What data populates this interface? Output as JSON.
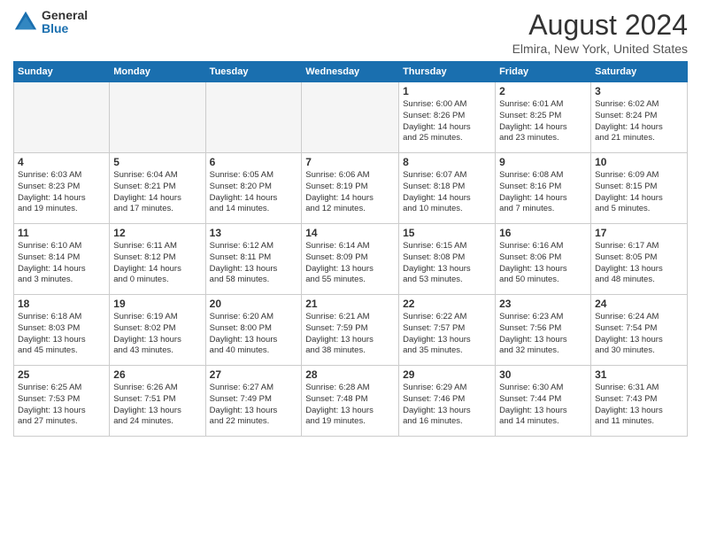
{
  "header": {
    "logo_general": "General",
    "logo_blue": "Blue",
    "month_title": "August 2024",
    "location": "Elmira, New York, United States"
  },
  "weekdays": [
    "Sunday",
    "Monday",
    "Tuesday",
    "Wednesday",
    "Thursday",
    "Friday",
    "Saturday"
  ],
  "weeks": [
    [
      {
        "day": "",
        "info": ""
      },
      {
        "day": "",
        "info": ""
      },
      {
        "day": "",
        "info": ""
      },
      {
        "day": "",
        "info": ""
      },
      {
        "day": "1",
        "info": "Sunrise: 6:00 AM\nSunset: 8:26 PM\nDaylight: 14 hours\nand 25 minutes."
      },
      {
        "day": "2",
        "info": "Sunrise: 6:01 AM\nSunset: 8:25 PM\nDaylight: 14 hours\nand 23 minutes."
      },
      {
        "day": "3",
        "info": "Sunrise: 6:02 AM\nSunset: 8:24 PM\nDaylight: 14 hours\nand 21 minutes."
      }
    ],
    [
      {
        "day": "4",
        "info": "Sunrise: 6:03 AM\nSunset: 8:23 PM\nDaylight: 14 hours\nand 19 minutes."
      },
      {
        "day": "5",
        "info": "Sunrise: 6:04 AM\nSunset: 8:21 PM\nDaylight: 14 hours\nand 17 minutes."
      },
      {
        "day": "6",
        "info": "Sunrise: 6:05 AM\nSunset: 8:20 PM\nDaylight: 14 hours\nand 14 minutes."
      },
      {
        "day": "7",
        "info": "Sunrise: 6:06 AM\nSunset: 8:19 PM\nDaylight: 14 hours\nand 12 minutes."
      },
      {
        "day": "8",
        "info": "Sunrise: 6:07 AM\nSunset: 8:18 PM\nDaylight: 14 hours\nand 10 minutes."
      },
      {
        "day": "9",
        "info": "Sunrise: 6:08 AM\nSunset: 8:16 PM\nDaylight: 14 hours\nand 7 minutes."
      },
      {
        "day": "10",
        "info": "Sunrise: 6:09 AM\nSunset: 8:15 PM\nDaylight: 14 hours\nand 5 minutes."
      }
    ],
    [
      {
        "day": "11",
        "info": "Sunrise: 6:10 AM\nSunset: 8:14 PM\nDaylight: 14 hours\nand 3 minutes."
      },
      {
        "day": "12",
        "info": "Sunrise: 6:11 AM\nSunset: 8:12 PM\nDaylight: 14 hours\nand 0 minutes."
      },
      {
        "day": "13",
        "info": "Sunrise: 6:12 AM\nSunset: 8:11 PM\nDaylight: 13 hours\nand 58 minutes."
      },
      {
        "day": "14",
        "info": "Sunrise: 6:14 AM\nSunset: 8:09 PM\nDaylight: 13 hours\nand 55 minutes."
      },
      {
        "day": "15",
        "info": "Sunrise: 6:15 AM\nSunset: 8:08 PM\nDaylight: 13 hours\nand 53 minutes."
      },
      {
        "day": "16",
        "info": "Sunrise: 6:16 AM\nSunset: 8:06 PM\nDaylight: 13 hours\nand 50 minutes."
      },
      {
        "day": "17",
        "info": "Sunrise: 6:17 AM\nSunset: 8:05 PM\nDaylight: 13 hours\nand 48 minutes."
      }
    ],
    [
      {
        "day": "18",
        "info": "Sunrise: 6:18 AM\nSunset: 8:03 PM\nDaylight: 13 hours\nand 45 minutes."
      },
      {
        "day": "19",
        "info": "Sunrise: 6:19 AM\nSunset: 8:02 PM\nDaylight: 13 hours\nand 43 minutes."
      },
      {
        "day": "20",
        "info": "Sunrise: 6:20 AM\nSunset: 8:00 PM\nDaylight: 13 hours\nand 40 minutes."
      },
      {
        "day": "21",
        "info": "Sunrise: 6:21 AM\nSunset: 7:59 PM\nDaylight: 13 hours\nand 38 minutes."
      },
      {
        "day": "22",
        "info": "Sunrise: 6:22 AM\nSunset: 7:57 PM\nDaylight: 13 hours\nand 35 minutes."
      },
      {
        "day": "23",
        "info": "Sunrise: 6:23 AM\nSunset: 7:56 PM\nDaylight: 13 hours\nand 32 minutes."
      },
      {
        "day": "24",
        "info": "Sunrise: 6:24 AM\nSunset: 7:54 PM\nDaylight: 13 hours\nand 30 minutes."
      }
    ],
    [
      {
        "day": "25",
        "info": "Sunrise: 6:25 AM\nSunset: 7:53 PM\nDaylight: 13 hours\nand 27 minutes."
      },
      {
        "day": "26",
        "info": "Sunrise: 6:26 AM\nSunset: 7:51 PM\nDaylight: 13 hours\nand 24 minutes."
      },
      {
        "day": "27",
        "info": "Sunrise: 6:27 AM\nSunset: 7:49 PM\nDaylight: 13 hours\nand 22 minutes."
      },
      {
        "day": "28",
        "info": "Sunrise: 6:28 AM\nSunset: 7:48 PM\nDaylight: 13 hours\nand 19 minutes."
      },
      {
        "day": "29",
        "info": "Sunrise: 6:29 AM\nSunset: 7:46 PM\nDaylight: 13 hours\nand 16 minutes."
      },
      {
        "day": "30",
        "info": "Sunrise: 6:30 AM\nSunset: 7:44 PM\nDaylight: 13 hours\nand 14 minutes."
      },
      {
        "day": "31",
        "info": "Sunrise: 6:31 AM\nSunset: 7:43 PM\nDaylight: 13 hours\nand 11 minutes."
      }
    ]
  ]
}
